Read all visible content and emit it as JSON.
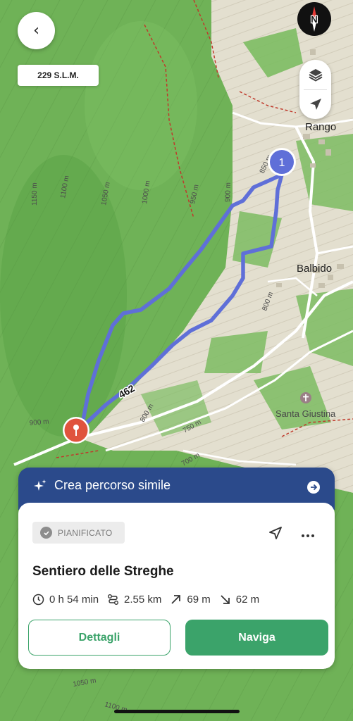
{
  "map": {
    "altitude_badge": "229 S.L.M.",
    "places": {
      "rango": "Rango",
      "balbido": "Balbido",
      "santa_giustina": "Santa Giustina"
    },
    "route_number": "462",
    "waypoint_number": "1",
    "contour_labels": {
      "c1150": "1150 m",
      "c1100": "1100 m",
      "c1050": "1050 m",
      "c1000": "1000 m",
      "c950": "950 m",
      "c900a": "900 m",
      "c850": "850 m",
      "c800a": "800 m",
      "c900b": "900 m",
      "c800b": "800 m",
      "c750": "750 m",
      "c700": "700 m",
      "c1050b": "1050 m",
      "c1100b": "1100 m"
    },
    "colors": {
      "forest": "#6fb257",
      "route": "#5f6fd8",
      "pin": "#e0533d",
      "trail_dash": "#c0392b"
    }
  },
  "compass": {
    "letter": "N"
  },
  "similar_route": {
    "label": "Crea percorso simile"
  },
  "trail": {
    "status": "PIANIFICATO",
    "title": "Sentiero delle Streghe",
    "duration": "0 h 54 min",
    "distance": "2.55 km",
    "ascent": "69 m",
    "descent": "62 m"
  },
  "actions": {
    "details": "Dettagli",
    "navigate": "Naviga"
  },
  "accent_color": "#3ba36a",
  "banner_color": "#2b4a8b"
}
